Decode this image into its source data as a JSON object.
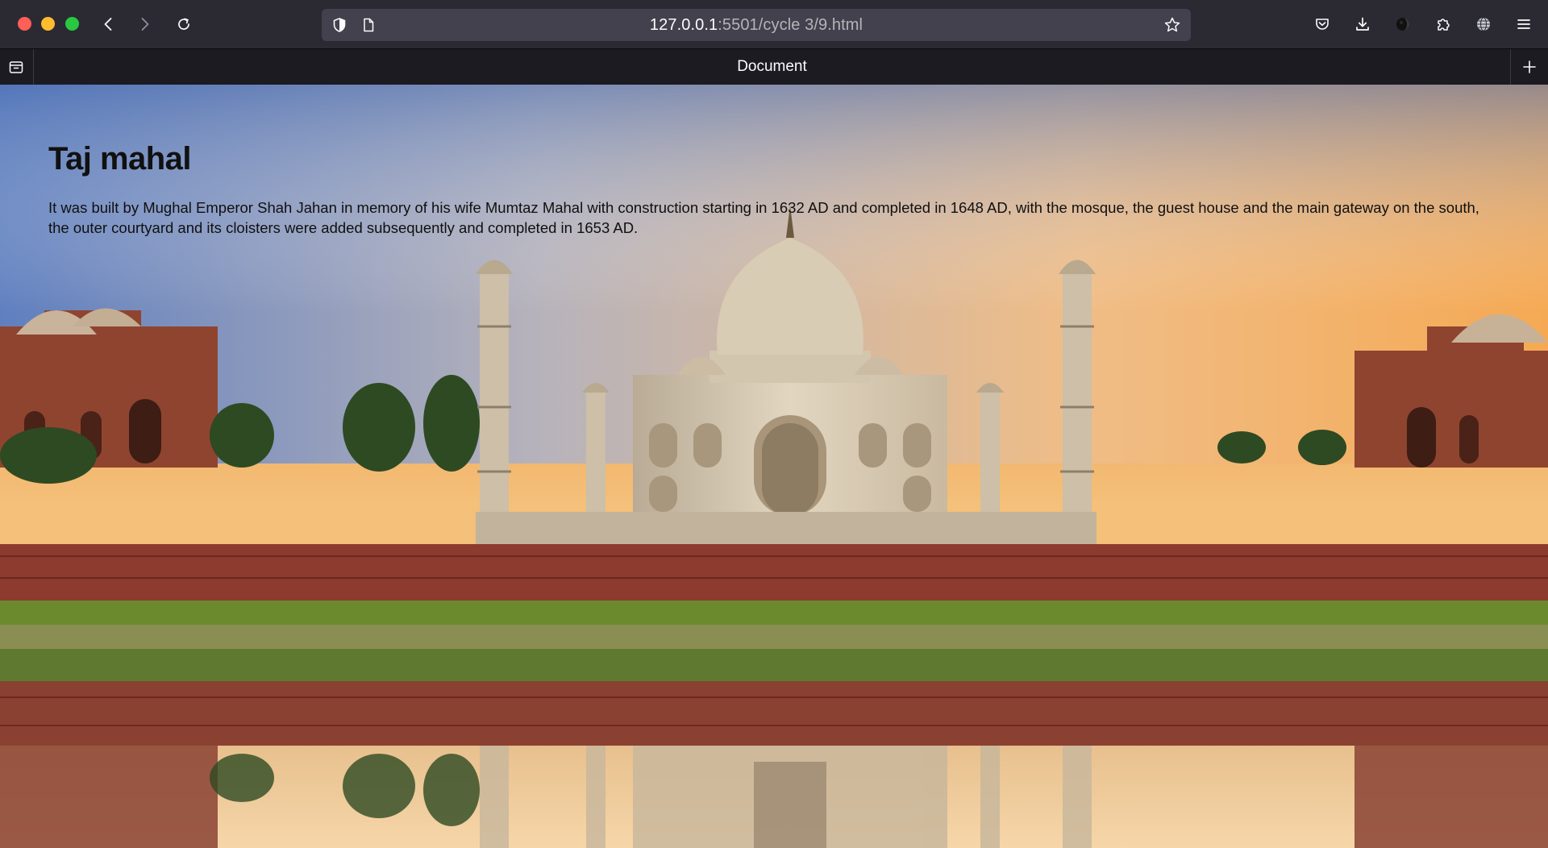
{
  "browser": {
    "url_host": "127.0.0.1",
    "url_path": ":5501/cycle 3/9.html",
    "tab_title": "Document",
    "icons": {
      "back": "chevron-left-icon",
      "forward": "chevron-right-icon",
      "reload": "reload-icon",
      "tracking": "shield-icon",
      "page": "page-icon",
      "bookmark": "star-icon",
      "pocket": "pocket-icon",
      "downloads": "download-icon",
      "account": "account-icon",
      "extensions": "puzzle-icon",
      "language": "globe-icon",
      "menu": "hamburger-menu-icon",
      "tabs_list": "tab-list-icon",
      "new_tab": "plus-icon"
    }
  },
  "page": {
    "title": "Taj mahal",
    "paragraph": "It was built by Mughal Emperor Shah Jahan in memory of his wife Mumtaz Mahal with construction starting in 1632 AD and completed in 1648 AD, with the mosque, the guest house and the main gateway on the south, the outer courtyard and its cloisters were added subsequently and completed in 1653 AD."
  },
  "colors": {
    "chrome_toolbar": "#2b2a33",
    "chrome_tabstrip": "#1c1b22",
    "urlbar": "#42414d",
    "sky_top": "#6f8fc8",
    "sky_warm": "#f2b66e",
    "marble": "#d8ccb6",
    "red_sandstone": "#8c3b2e",
    "grass": "#6b8a2e"
  }
}
